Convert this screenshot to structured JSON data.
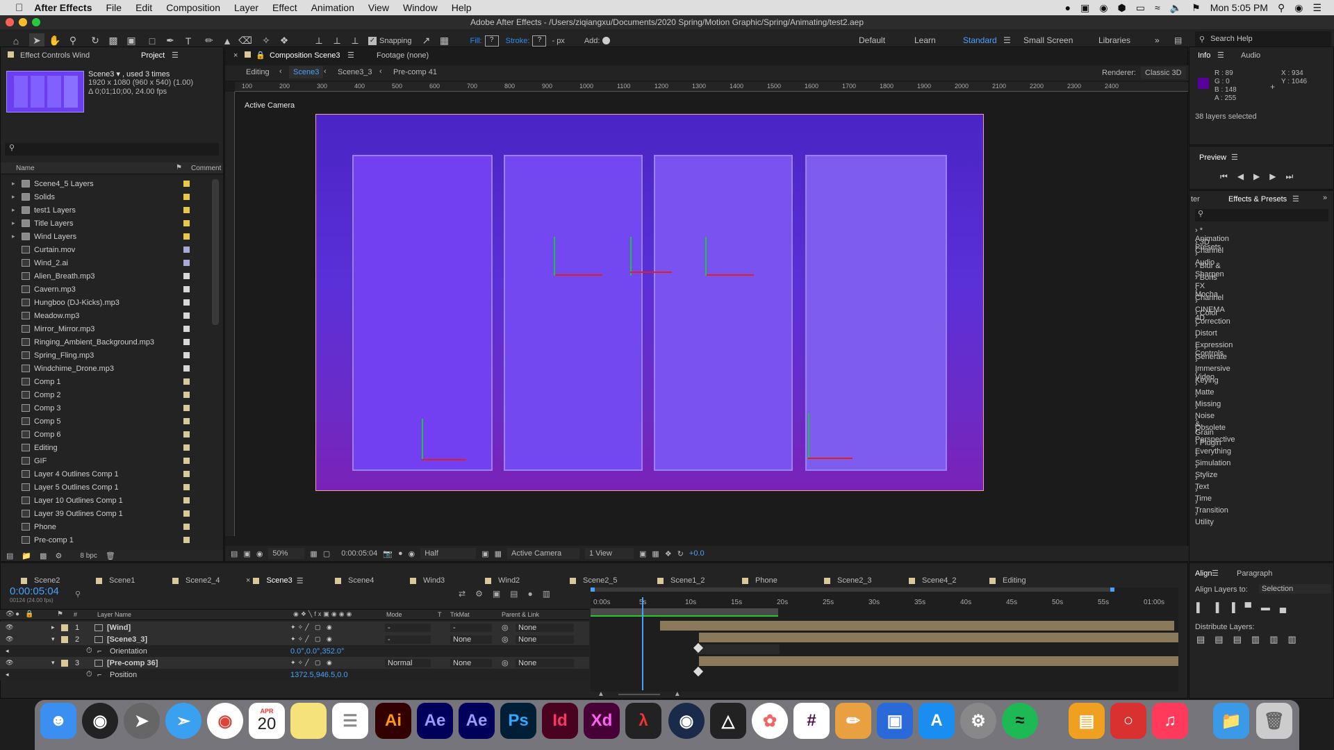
{
  "menubar": {
    "app": "After Effects",
    "items": [
      "File",
      "Edit",
      "Composition",
      "Layer",
      "Effect",
      "Animation",
      "View",
      "Window",
      "Help"
    ],
    "clock": "Mon 5:05 PM"
  },
  "window": {
    "title": "Adobe After Effects - /Users/ziqiangxu/Documents/2020 Spring/Motion Graphic/Spring/Animating/test2.aep"
  },
  "toolbar": {
    "snapping": "Snapping",
    "fill": "Fill:",
    "stroke": "Stroke:",
    "px": "- px",
    "add": "Add:",
    "workspaces": [
      "Default",
      "Learn",
      "Standard",
      "Small Screen",
      "Libraries"
    ],
    "search_placeholder": "Search Help"
  },
  "project": {
    "tabs": [
      "Effect Controls Wind",
      "Project"
    ],
    "item_name": "Scene3 ▾ , used 3 times",
    "item_size": "1920 x 1080  (960 x 540) (1.00)",
    "item_duration": "Δ 0;01;10;00, 24.00 fps",
    "col_name": "Name",
    "col_comment": "Comment",
    "bpc": "8 bpc",
    "items": [
      {
        "name": "Scene4_5 Layers",
        "type": "folder",
        "color": "#e8c84a"
      },
      {
        "name": "Solids",
        "type": "folder",
        "color": "#e8c84a"
      },
      {
        "name": "test1 Layers",
        "type": "folder",
        "color": "#e8c84a"
      },
      {
        "name": "Title Layers",
        "type": "folder",
        "color": "#e8c84a"
      },
      {
        "name": "Wind Layers",
        "type": "folder",
        "color": "#e8c84a"
      },
      {
        "name": "Curtain.mov",
        "type": "file",
        "color": "#a9a9d8"
      },
      {
        "name": "Wind_2.ai",
        "type": "file",
        "color": "#a9a9d8"
      },
      {
        "name": "Alien_Breath.mp3",
        "type": "file",
        "color": "#d8d8d8"
      },
      {
        "name": "Cavern.mp3",
        "type": "file",
        "color": "#d8d8d8"
      },
      {
        "name": "Hungboo (DJ-Kicks).mp3",
        "type": "file",
        "color": "#d8d8d8"
      },
      {
        "name": "Meadow.mp3",
        "type": "file",
        "color": "#d8d8d8"
      },
      {
        "name": "Mirror_Mirror.mp3",
        "type": "file",
        "color": "#d8d8d8"
      },
      {
        "name": "Ringing_Ambient_Background.mp3",
        "type": "file",
        "color": "#d8d8d8"
      },
      {
        "name": "Spring_Fling.mp3",
        "type": "file",
        "color": "#d8d8d8"
      },
      {
        "name": "Windchime_Drone.mp3",
        "type": "file",
        "color": "#d8d8d8"
      },
      {
        "name": "Comp 1",
        "type": "comp",
        "color": "#d8c89a"
      },
      {
        "name": "Comp 2",
        "type": "comp",
        "color": "#d8c89a"
      },
      {
        "name": "Comp 3",
        "type": "comp",
        "color": "#d8c89a"
      },
      {
        "name": "Comp 5",
        "type": "comp",
        "color": "#d8c89a"
      },
      {
        "name": "Comp 6",
        "type": "comp",
        "color": "#d8c89a"
      },
      {
        "name": "Editing",
        "type": "comp",
        "color": "#d8c89a"
      },
      {
        "name": "GIF",
        "type": "comp",
        "color": "#d8c89a"
      },
      {
        "name": "Layer 4 Outlines Comp 1",
        "type": "comp",
        "color": "#d8c89a"
      },
      {
        "name": "Layer 5 Outlines Comp 1",
        "type": "comp",
        "color": "#d8c89a"
      },
      {
        "name": "Layer 10 Outlines Comp 1",
        "type": "comp",
        "color": "#d8c89a"
      },
      {
        "name": "Layer 39 Outlines Comp 1",
        "type": "comp",
        "color": "#d8c89a"
      },
      {
        "name": "Phone",
        "type": "comp",
        "color": "#d8c89a"
      },
      {
        "name": "Pre-comp 1",
        "type": "comp",
        "color": "#d8c89a"
      }
    ]
  },
  "comp": {
    "tab": "Composition Scene3",
    "footage": "Footage (none)",
    "breadcrumbs": [
      "Editing",
      "Scene3",
      "Scene3_3",
      "Pre-comp 41"
    ],
    "renderer_label": "Renderer:",
    "renderer": "Classic 3D",
    "view_label": "Active Camera",
    "ruler": [
      "100",
      "200",
      "300",
      "400",
      "500",
      "600",
      "700",
      "800",
      "900",
      "1000",
      "1100",
      "1200",
      "1300",
      "1400",
      "1500",
      "1600",
      "1700",
      "1800",
      "1900",
      "2000",
      "2100",
      "2200",
      "2300",
      "2400"
    ],
    "zoom": "50%",
    "timecode": "0:00:05:04",
    "resolution": "Half",
    "camera": "Active Camera",
    "views": "1 View",
    "exposure": "+0.0"
  },
  "info": {
    "tabs": [
      "Info",
      "Audio"
    ],
    "r": "R : 89",
    "g": "G : 0",
    "b": "B : 148",
    "a": "A : 255",
    "x": "X : 934",
    "y": "Y : 1046",
    "selected": "38 layers selected",
    "swatch": "#59009a"
  },
  "preview": {
    "title": "Preview"
  },
  "effects": {
    "tab_left": "ter",
    "title": "Effects & Presets",
    "items": [
      "* Animation Presets",
      "3D Channel",
      "Audio",
      "Blur & Sharpen",
      "Boris FX Mocha",
      "Channel",
      "CINEMA 4D",
      "Color Correction",
      "Distort",
      "Expression Controls",
      "Generate",
      "Immersive Video",
      "Keying",
      "Matte",
      "Missing",
      "Noise & Grain",
      "Obsolete",
      "Perspective",
      "Plugin Everything",
      "Simulation",
      "Stylize",
      "Text",
      "Time",
      "Transition",
      "Utility"
    ]
  },
  "timeline": {
    "tabs": [
      {
        "name": "Scene2",
        "color": "#d8c89a"
      },
      {
        "name": "Scene1",
        "color": "#d8c89a"
      },
      {
        "name": "Scene2_4",
        "color": "#d8c89a"
      },
      {
        "name": "Scene3",
        "color": "#d8c89a",
        "active": true
      },
      {
        "name": "Scene4",
        "color": "#d8c89a"
      },
      {
        "name": "Wind3",
        "color": "#d8c89a"
      },
      {
        "name": "Wind2",
        "color": "#d8c89a"
      },
      {
        "name": "Scene2_5",
        "color": "#d8c89a"
      },
      {
        "name": "Scene1_2",
        "color": "#d8c89a"
      },
      {
        "name": "Phone",
        "color": "#d8c89a"
      },
      {
        "name": "Scene2_3",
        "color": "#d8c89a"
      },
      {
        "name": "Scene4_2",
        "color": "#d8c89a"
      },
      {
        "name": "Editing",
        "color": "#d8c89a"
      }
    ],
    "timecode": "0:00:05:04",
    "frames": "00124 (24.00 fps)",
    "headers": {
      "layer_name": "Layer Name",
      "mode": "Mode",
      "t": "T",
      "trkmat": "TrkMat",
      "parent": "Parent & Link"
    },
    "ruler": [
      "0:00s",
      "5s",
      "10s",
      "15s",
      "20s",
      "25s",
      "30s",
      "35s",
      "40s",
      "45s",
      "50s",
      "55s",
      "01:00s"
    ],
    "layers": [
      {
        "num": "1",
        "name": "[Wind]",
        "mode": "-",
        "trkmat": "-",
        "parent": "None"
      },
      {
        "num": "2",
        "name": "[Scene3_3]",
        "mode": "-",
        "trkmat": "None",
        "parent": "None"
      },
      {
        "num": "",
        "name": "Orientation",
        "value": "0.0°,0.0°,352.0°"
      },
      {
        "num": "3",
        "name": "[Pre-comp 36]",
        "mode": "Normal",
        "trkmat": "None",
        "parent": "None"
      },
      {
        "num": "",
        "name": "Position",
        "value": "1372.5,946.5,0.0"
      }
    ]
  },
  "align": {
    "tabs": [
      "Align",
      "Paragraph"
    ],
    "align_to_label": "Align Layers to:",
    "align_to": "Selection",
    "distribute": "Distribute Layers:"
  },
  "dock": {
    "calendar_month": "APR",
    "calendar_day": "20",
    "apps": [
      "Ai",
      "Ae",
      "Ae",
      "Ps",
      "Id",
      "Xd"
    ]
  }
}
